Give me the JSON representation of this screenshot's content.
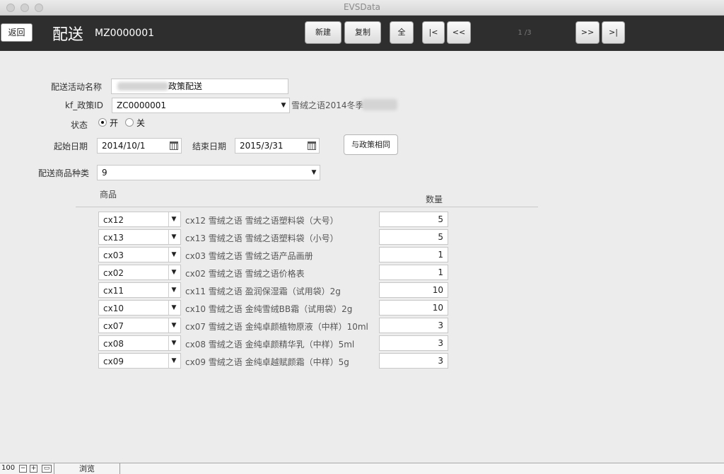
{
  "window": {
    "title": "EVSData"
  },
  "toolbar": {
    "back_label": "返回",
    "page_title": "配送",
    "record_id": "MZ0000001",
    "new_label": "新建",
    "copy_label": "复制",
    "all_label": "全",
    "first_label": "|<",
    "prev_label": "<<",
    "page_count": "1 /3",
    "next_label": ">>",
    "last_label": ">|"
  },
  "form": {
    "activity_name_label": "配送活动名称",
    "activity_name_value": "政策配送",
    "policy_id_label": "kf_政策ID",
    "policy_id_value": "ZC0000001",
    "policy_desc": "雪绒之语2014冬季",
    "status_label": "状态",
    "status_on": "开",
    "status_off": "关",
    "status_selected": "开",
    "start_date_label": "起始日期",
    "start_date_value": "2014/10/1",
    "end_date_label": "结束日期",
    "end_date_value": "2015/3/31",
    "same_as_policy_label": "与政策相同",
    "product_types_label": "配送商品种类",
    "product_types_value": "9"
  },
  "table": {
    "col_product": "商品",
    "col_quantity": "数量",
    "rows": [
      {
        "code": "cx12",
        "desc": "cx12 雪绒之语 雪绒之语塑料袋（大号）",
        "qty": "5"
      },
      {
        "code": "cx13",
        "desc": "cx13 雪绒之语 雪绒之语塑料袋（小号）",
        "qty": "5"
      },
      {
        "code": "cx03",
        "desc": "cx03 雪绒之语 雪绒之语产品画册",
        "qty": "1"
      },
      {
        "code": "cx02",
        "desc": "cx02 雪绒之语 雪绒之语价格表",
        "qty": "1"
      },
      {
        "code": "cx11",
        "desc": "cx11 雪绒之语 盈润保湿霜（试用袋）2g",
        "qty": "10"
      },
      {
        "code": "cx10",
        "desc": "cx10 雪绒之语 金纯雪绒BB霜（试用袋）2g",
        "qty": "10"
      },
      {
        "code": "cx07",
        "desc": "cx07 雪绒之语 金纯卓颜植物原液（中样）10ml",
        "qty": "3"
      },
      {
        "code": "cx08",
        "desc": "cx08 雪绒之语 金纯卓颜精华乳（中样）5ml",
        "qty": "3"
      },
      {
        "code": "cx09",
        "desc": "cx09 雪绒之语 金纯卓越赋颜霜（中样）5g",
        "qty": "3"
      }
    ]
  },
  "statusbar": {
    "zoom": "100",
    "mode": "浏览"
  }
}
